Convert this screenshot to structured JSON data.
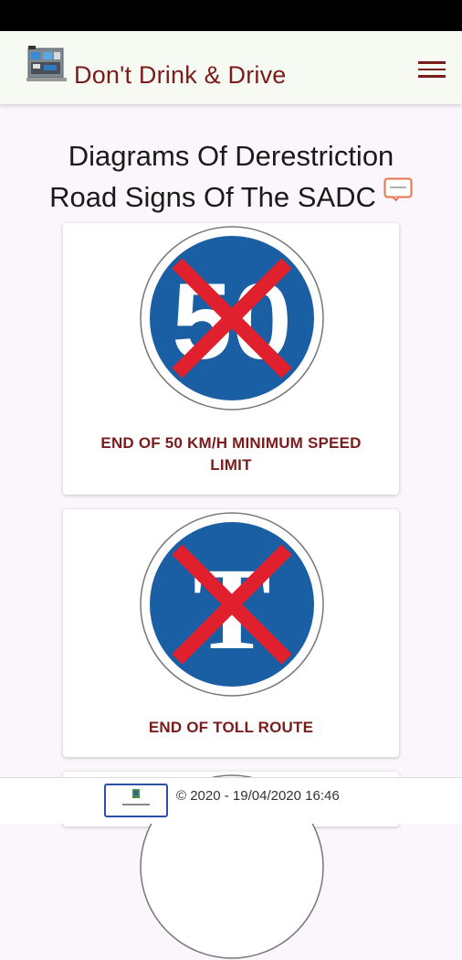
{
  "app": {
    "title": "Don't Drink & Drive",
    "accent_color": "#7b1c1c"
  },
  "header": {
    "menu_icon": "hamburger-menu-icon"
  },
  "page": {
    "title_line1": "Diagrams Of Derestriction",
    "title_line2": "Road Signs Of The SADC"
  },
  "cards": [
    {
      "sign_text": "50",
      "caption": "END OF 50 KM/H MINIMUM SPEED LIMIT"
    },
    {
      "sign_text": "T",
      "caption": "END OF TOLL ROUTE"
    }
  ],
  "footer": {
    "text": "© 2020 - 19/04/2020 16:46"
  }
}
